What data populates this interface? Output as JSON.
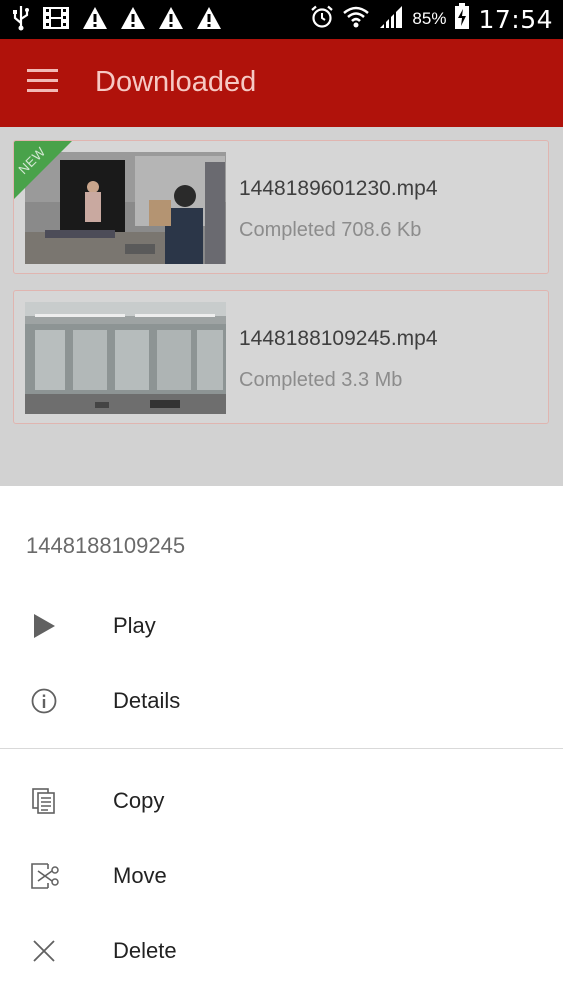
{
  "status_bar": {
    "battery_percent": "85%",
    "time": "17:54",
    "icons": [
      "usb-icon",
      "video-icon",
      "warning-icon",
      "warning-icon",
      "warning-icon",
      "warning-icon",
      "alarm-icon",
      "wifi-icon",
      "signal-icon",
      "battery-charging-icon"
    ]
  },
  "app_bar": {
    "title": "Downloaded",
    "color": "#b0120b"
  },
  "downloads": [
    {
      "filename": "1448189601230.mp4",
      "status": "Completed 708.6 Kb",
      "badge": "NEW"
    },
    {
      "filename": "1448188109245.mp4",
      "status": "Completed 3.3 Mb"
    }
  ],
  "sheet": {
    "title": "1448188109245",
    "actions": [
      {
        "label": "Play",
        "icon": "play-icon"
      },
      {
        "label": "Details",
        "icon": "info-icon"
      },
      {
        "label": "Copy",
        "icon": "copy-icon"
      },
      {
        "label": "Move",
        "icon": "move-icon"
      },
      {
        "label": "Delete",
        "icon": "close-icon"
      }
    ]
  }
}
